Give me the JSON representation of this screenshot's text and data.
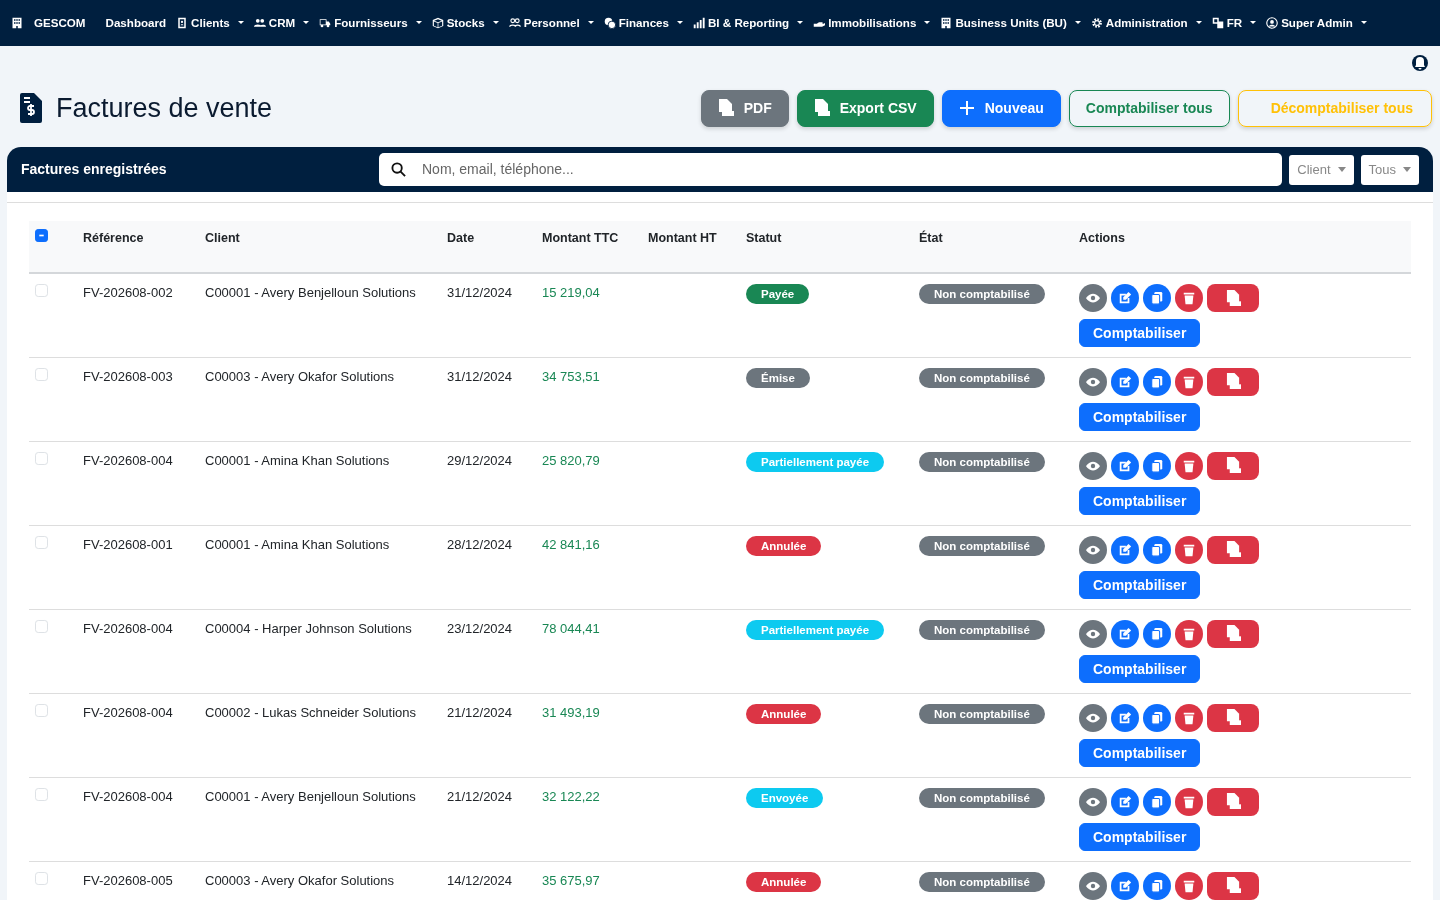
{
  "navbar": {
    "brand": {
      "label": "GESCOM"
    },
    "items": [
      {
        "label": "Dashboard",
        "dropdown": false
      },
      {
        "label": "Clients",
        "dropdown": true
      },
      {
        "label": "CRM",
        "dropdown": true
      },
      {
        "label": "Fournisseurs",
        "dropdown": true
      },
      {
        "label": "Stocks",
        "dropdown": true
      },
      {
        "label": "Personnel",
        "dropdown": true
      },
      {
        "label": "Finances",
        "dropdown": true
      },
      {
        "label": "BI & Reporting",
        "dropdown": true
      },
      {
        "label": "Immobilisations",
        "dropdown": true
      },
      {
        "label": "Business Units (BU)",
        "dropdown": true
      },
      {
        "label": "Administration",
        "dropdown": true
      },
      {
        "label": "FR",
        "dropdown": true
      },
      {
        "label": "Super Admin",
        "dropdown": true
      }
    ]
  },
  "page": {
    "title": "Factures de vente",
    "buttons": [
      {
        "label": "PDF",
        "kind": "pdf"
      },
      {
        "label": "Export CSV",
        "kind": "csv"
      },
      {
        "label": "Nouveau",
        "kind": "new"
      },
      {
        "label": "Comptabiliser tous",
        "kind": "post"
      },
      {
        "label": "Décomptabiliser tous",
        "kind": "unpost"
      }
    ]
  },
  "card": {
    "title": "Factures enregistrées",
    "search": {
      "placeholder": "Nom, email, téléphone..."
    },
    "filters": [
      "Client",
      "Tous"
    ]
  },
  "table": {
    "select_all": {
      "indeterminate": true
    },
    "columns": [
      "Référence",
      "Client",
      "Date",
      "Montant TTC",
      "Montant HT",
      "Statut",
      "État",
      "Actions"
    ],
    "rows": [
      {
        "checked": false,
        "reference": "FV-202608-002",
        "client": "C00001 - Avery Benjelloun Solutions",
        "date": "31/12/2024",
        "amount_ttc": "15 219,04",
        "status": "Payée",
        "color": "#198754",
        "state": "Non comptabilisé",
        "action": "Comptabiliser"
      },
      {
        "checked": false,
        "reference": "FV-202608-003",
        "client": "C00003 - Avery Okafor Solutions",
        "date": "31/12/2024",
        "amount_ttc": "34 753,51",
        "status": "Émise",
        "color": "#6c757d",
        "state": "Non comptabilisé",
        "action": "Comptabiliser"
      },
      {
        "checked": false,
        "reference": "FV-202608-004",
        "client": "C00001 - Amina Khan Solutions",
        "date": "29/12/2024",
        "amount_ttc": "25 820,79",
        "status": "Partiellement payée",
        "color": "#0dcaf0",
        "state": "Non comptabilisé",
        "action": "Comptabiliser"
      },
      {
        "checked": false,
        "reference": "FV-202608-001",
        "client": "C00001 - Amina Khan Solutions",
        "date": "28/12/2024",
        "amount_ttc": "42 841,16",
        "status": "Annulée",
        "color": "#dc3545",
        "state": "Non comptabilisé",
        "action": "Comptabiliser"
      },
      {
        "checked": false,
        "reference": "FV-202608-004",
        "client": "C00004 - Harper Johnson Solutions",
        "date": "23/12/2024",
        "amount_ttc": "78 044,41",
        "status": "Partiellement payée",
        "color": "#0dcaf0",
        "state": "Non comptabilisé",
        "action": "Comptabiliser"
      },
      {
        "checked": false,
        "reference": "FV-202608-004",
        "client": "C00002 - Lukas Schneider Solutions",
        "date": "21/12/2024",
        "amount_ttc": "31 493,19",
        "status": "Annulée",
        "color": "#dc3545",
        "state": "Non comptabilisé",
        "action": "Comptabiliser"
      },
      {
        "checked": false,
        "reference": "FV-202608-004",
        "client": "C00001 - Avery Benjelloun Solutions",
        "date": "21/12/2024",
        "amount_ttc": "32 122,22",
        "status": "Envoyée",
        "color": "#0dcaf0",
        "state": "Non comptabilisé",
        "action": "Comptabiliser"
      },
      {
        "checked": false,
        "reference": "FV-202608-005",
        "client": "C00003 - Avery Okafor Solutions",
        "date": "14/12/2024",
        "amount_ttc": "35 675,97",
        "status": "Annulée",
        "color": "#dc3545",
        "state": "Non comptabilisé"
      }
    ]
  }
}
